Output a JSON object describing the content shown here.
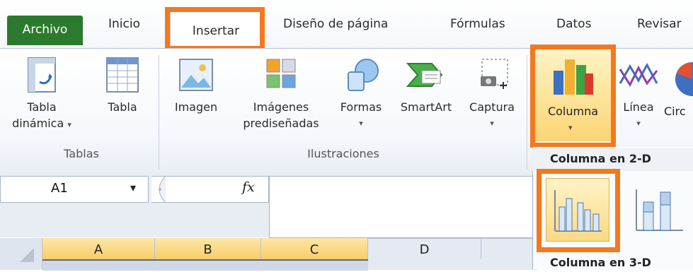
{
  "tabs": {
    "file": "Archivo",
    "home": "Inicio",
    "insert": "Insertar",
    "layout": "Diseño de página",
    "formulas": "Fórmulas",
    "data": "Datos",
    "review": "Revisar"
  },
  "ribbon": {
    "pivot_line1": "Tabla",
    "pivot_line2": "dinámica",
    "table": "Tabla",
    "group_tables": "Tablas",
    "image": "Imagen",
    "clipart_line1": "Imágenes",
    "clipart_line2": "prediseñadas",
    "shapes": "Formas",
    "smartart": "SmartArt",
    "capture": "Captura",
    "group_illustrations": "Ilustraciones",
    "column": "Columna",
    "line": "Línea",
    "circle_partial": "Circ"
  },
  "formula_bar": {
    "name_box": "A1",
    "fx": "fx"
  },
  "grid": {
    "columns": [
      "A",
      "B",
      "C",
      "D"
    ]
  },
  "dropdown": {
    "section_2d": "Columna en 2-D",
    "section_3d": "Columna en 3-D"
  },
  "colors": {
    "file_tab": "#2c7a2e",
    "highlight": "#f4791e",
    "selected": "#f7cd67"
  }
}
